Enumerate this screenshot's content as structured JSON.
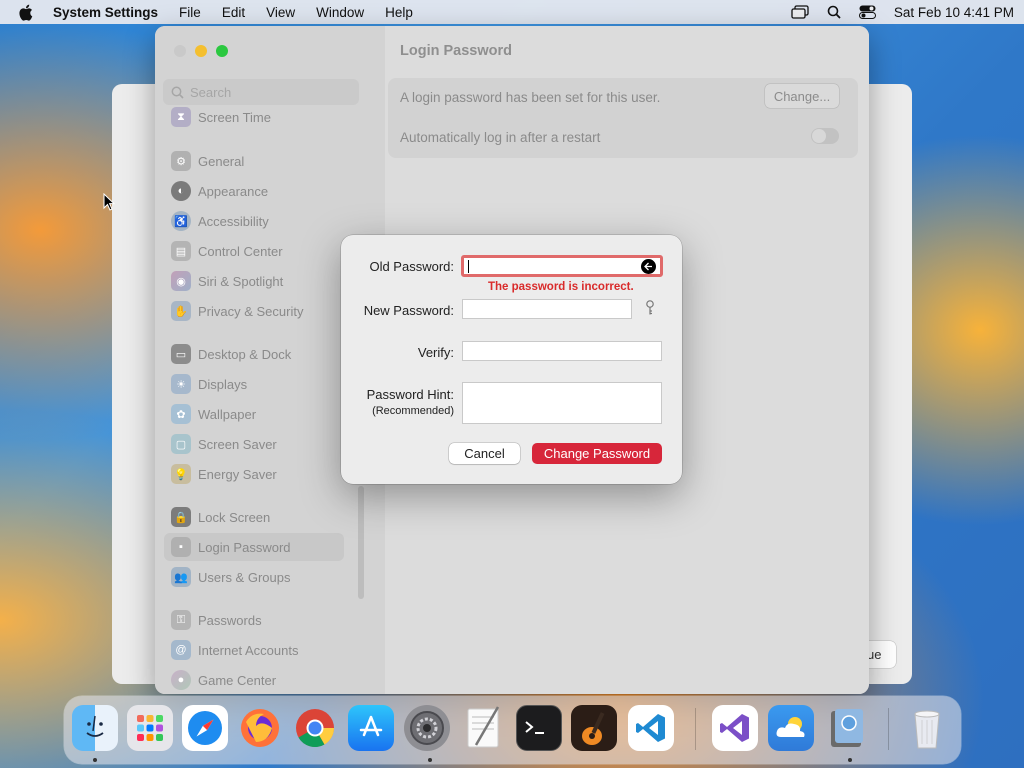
{
  "menubar": {
    "app_name": "System Settings",
    "menus": [
      "File",
      "Edit",
      "View",
      "Window",
      "Help"
    ],
    "datetime": "Sat Feb 10  4:41 PM"
  },
  "back_window": {
    "button_label": "ue"
  },
  "settings": {
    "title": "Login Password",
    "search_placeholder": "Search",
    "sidebar": {
      "items": [
        {
          "label": "Screen Time",
          "icon": "hourglass-icon"
        },
        {
          "label": "General",
          "icon": "gear-icon"
        },
        {
          "label": "Appearance",
          "icon": "appearance-icon"
        },
        {
          "label": "Accessibility",
          "icon": "accessibility-icon"
        },
        {
          "label": "Control Center",
          "icon": "control-center-icon"
        },
        {
          "label": "Siri & Spotlight",
          "icon": "siri-icon"
        },
        {
          "label": "Privacy & Security",
          "icon": "hand-icon"
        },
        {
          "label": "Desktop & Dock",
          "icon": "desktop-dock-icon"
        },
        {
          "label": "Displays",
          "icon": "sun-icon"
        },
        {
          "label": "Wallpaper",
          "icon": "wallpaper-icon"
        },
        {
          "label": "Screen Saver",
          "icon": "screen-saver-icon"
        },
        {
          "label": "Energy Saver",
          "icon": "lightbulb-icon"
        },
        {
          "label": "Lock Screen",
          "icon": "lock-icon"
        },
        {
          "label": "Login Password",
          "icon": "password-icon"
        },
        {
          "label": "Users & Groups",
          "icon": "users-icon"
        },
        {
          "label": "Passwords",
          "icon": "key-icon"
        },
        {
          "label": "Internet Accounts",
          "icon": "at-icon"
        },
        {
          "label": "Game Center",
          "icon": "game-center-icon"
        }
      ],
      "selected": "Login Password"
    },
    "rows": {
      "password_set_text": "A login password has been set for this user.",
      "change_button": "Change...",
      "auto_login_text": "Automatically log in after a restart",
      "auto_login_enabled": false
    },
    "help": "?"
  },
  "dialog": {
    "old_password_label": "Old Password:",
    "old_password_value": "",
    "error_text": "The password is incorrect.",
    "new_password_label": "New Password:",
    "new_password_value": "",
    "verify_label": "Verify:",
    "verify_value": "",
    "hint_label": "Password Hint:",
    "hint_sublabel": "(Recommended)",
    "hint_value": "",
    "cancel_button": "Cancel",
    "submit_button": "Change Password",
    "accent_color": "#d7263a",
    "error_color": "#d92b2b"
  },
  "dock": {
    "apps": [
      "Finder",
      "Launchpad",
      "Safari",
      "Firefox",
      "Chrome",
      "App Store",
      "System Settings",
      "TextEdit",
      "Terminal",
      "GarageBand",
      "VS Code",
      "Visual Studio",
      "Weather",
      "Preview",
      "Trash"
    ]
  }
}
